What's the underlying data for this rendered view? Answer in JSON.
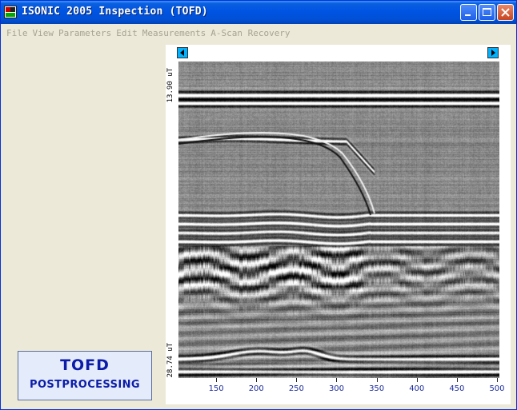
{
  "window": {
    "title": "ISONIC 2005 Inspection (TOFD)"
  },
  "menu": [
    "File",
    "View",
    "Parameters",
    "Edit",
    "Measurements",
    "A-Scan Recovery"
  ],
  "logo": {
    "line1": "TOFD",
    "line2": "POSTPROCESSING"
  },
  "scan": {
    "y_top_label": "13.90 uT",
    "y_bottom_label": "28.74 uT",
    "x_ticks": [
      "150",
      "200",
      "250",
      "300",
      "350",
      "400",
      "450",
      "500"
    ],
    "x_range": [
      103,
      503
    ]
  },
  "colors": {
    "titlebar": "#0054e3",
    "logo_text": "#0c1ca8",
    "axis_text": "#1a2b9c",
    "scroll_button": "#00b2ff"
  }
}
